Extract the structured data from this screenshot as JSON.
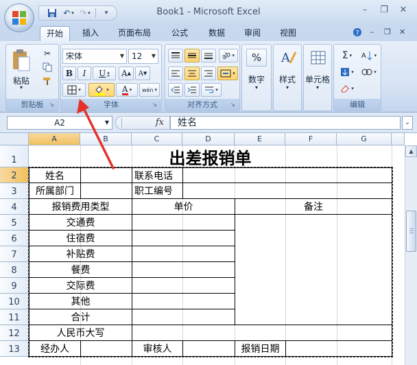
{
  "window": {
    "title": "Book1 - Microsoft Excel",
    "minimize": "–",
    "restore": "❐",
    "close": "✕"
  },
  "qat": {
    "save_icon": "save-icon",
    "undo_icon": "undo-icon",
    "redo_icon": "redo-icon"
  },
  "tabs": [
    "开始",
    "插入",
    "页面布局",
    "公式",
    "数据",
    "审阅",
    "视图"
  ],
  "ribbon": {
    "clipboard": {
      "label": "剪贴板",
      "paste": "粘贴"
    },
    "font": {
      "label": "字体",
      "font_name": "宋体",
      "font_size": "12",
      "bold": "B",
      "italic": "I",
      "underline": "U",
      "grow": "A",
      "shrink": "A",
      "font_color_letter": "A",
      "phonetic": "wén"
    },
    "alignment": {
      "label": "对齐方式"
    },
    "number": {
      "label": "数字",
      "symbol": "%"
    },
    "style": {
      "label": "样式"
    },
    "cells": {
      "label": "单元格"
    },
    "editing": {
      "label": "编辑",
      "sum": "Σ"
    }
  },
  "formula_bar": {
    "name_box": "A2",
    "fx": "fx",
    "content": "姓名"
  },
  "grid": {
    "columns": [
      "A",
      "B",
      "C",
      "D",
      "E",
      "F",
      "G"
    ],
    "rows": [
      "1",
      "2",
      "3",
      "4",
      "5",
      "6",
      "7",
      "8",
      "9",
      "10",
      "11",
      "12",
      "13"
    ],
    "title": "出差报销单",
    "r2": {
      "a": "姓名",
      "c": "联系电话"
    },
    "r3": {
      "a": "所属部门",
      "c": "职工编号"
    },
    "r4": {
      "a": "报销费用类型",
      "c": "单价",
      "e": "备注"
    },
    "types": [
      "交通费",
      "住宿费",
      "补贴费",
      "餐费",
      "交际费",
      "其他",
      "合计"
    ],
    "r12": {
      "a": "人民币大写"
    },
    "r13": {
      "a": "经办人",
      "c": "审核人",
      "e": "报销日期"
    }
  }
}
